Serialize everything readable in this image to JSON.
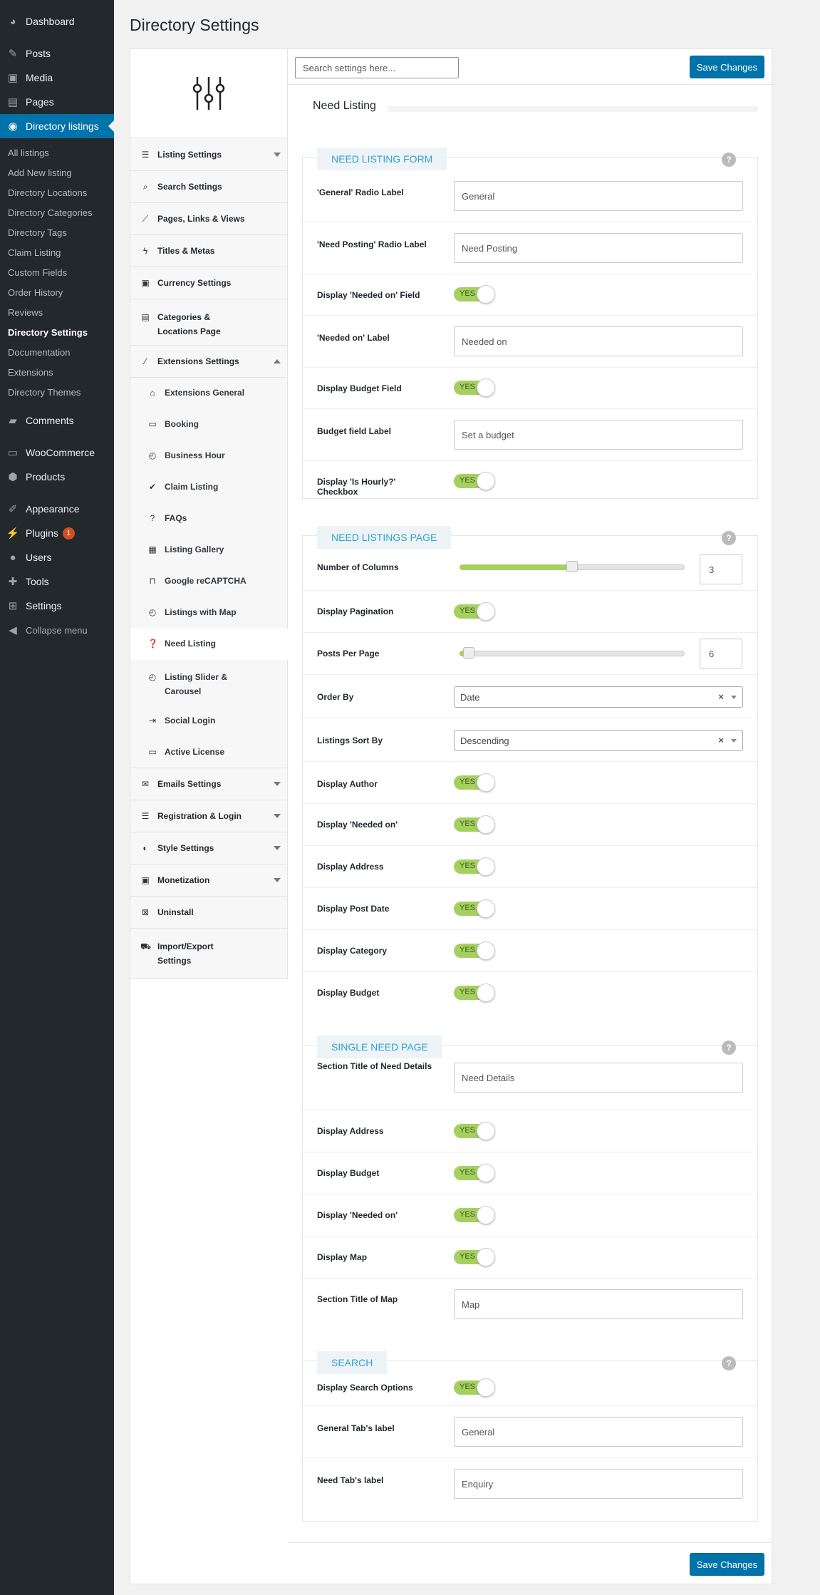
{
  "admin_menu": {
    "top_items": [
      {
        "label": "Dashboard",
        "icon": "dashboard-icon"
      },
      {
        "label": "Posts",
        "icon": "pin-icon"
      },
      {
        "label": "Media",
        "icon": "media-icon"
      },
      {
        "label": "Pages",
        "icon": "pages-icon"
      },
      {
        "label": "Directory listings",
        "icon": "directory-icon"
      }
    ],
    "sub_items": [
      "All listings",
      "Add New listing",
      "Directory Locations",
      "Directory Categories",
      "Directory Tags",
      "Claim Listing",
      "Custom Fields",
      "Order History",
      "Reviews",
      "Directory Settings",
      "Documentation",
      "Extensions",
      "Directory Themes"
    ],
    "bottom_items": [
      {
        "label": "Comments",
        "icon": "comments-icon"
      },
      {
        "label": "WooCommerce",
        "icon": "woocommerce-icon"
      },
      {
        "label": "Products",
        "icon": "products-icon"
      },
      {
        "label": "Appearance",
        "icon": "appearance-icon"
      },
      {
        "label": "Plugins",
        "icon": "plugins-icon",
        "badge": "1"
      },
      {
        "label": "Users",
        "icon": "users-icon"
      },
      {
        "label": "Tools",
        "icon": "tools-icon"
      },
      {
        "label": "Settings",
        "icon": "settings-icon"
      }
    ],
    "collapse_label": "Collapse menu"
  },
  "page_title": "Directory Settings",
  "search": {
    "placeholder": "Search settings here..."
  },
  "save_label": "Save Changes",
  "sidebar": {
    "items": [
      {
        "label": "Listing Settings",
        "icon": "list-icon"
      },
      {
        "label": "Search Settings",
        "icon": "search-icon"
      },
      {
        "label": "Pages, Links & Views",
        "icon": "chart-line-icon"
      },
      {
        "label": "Titles & Metas",
        "icon": "bolt-icon"
      },
      {
        "label": "Currency Settings",
        "icon": "money-icon"
      },
      {
        "label": "Categories & Locations Page",
        "icon": "categories-icon"
      },
      {
        "label": "Extensions Settings",
        "icon": "magic-wand-icon"
      },
      {
        "label": "Emails Settings",
        "icon": "envelope-icon"
      },
      {
        "label": "Registration & Login",
        "icon": "registration-icon"
      },
      {
        "label": "Style Settings",
        "icon": "adjust-icon"
      },
      {
        "label": "Monetization",
        "icon": "money-icon"
      },
      {
        "label": "Uninstall",
        "icon": "times-square-icon"
      },
      {
        "label": "Import/Export Settings",
        "icon": "truck-icon"
      }
    ],
    "extensions": [
      {
        "label": "Extensions General",
        "icon": "home-icon"
      },
      {
        "label": "Booking",
        "icon": "id-card-icon"
      },
      {
        "label": "Business Hour",
        "icon": "clock-icon"
      },
      {
        "label": "Claim Listing",
        "icon": "check-icon"
      },
      {
        "label": "FAQs",
        "icon": "question-icon"
      },
      {
        "label": "Listing Gallery",
        "icon": "grid-icon"
      },
      {
        "label": "Google reCAPTCHA",
        "icon": "unlock-icon"
      },
      {
        "label": "Listings with Map",
        "icon": "clock-icon"
      },
      {
        "label": "Need Listing",
        "icon": "question-circle-icon"
      },
      {
        "label": "Listing Slider & Carousel",
        "icon": "clock-icon"
      },
      {
        "label": "Social Login",
        "icon": "sign-in-icon"
      },
      {
        "label": "Active License",
        "icon": "id-card-icon"
      }
    ]
  },
  "section_title": "Need Listing",
  "help_glyph": "?",
  "groups": {
    "form": {
      "title": "NEED LISTING FORM",
      "rows": [
        {
          "label": "'General' Radio Label",
          "value": "General"
        },
        {
          "label": "'Need Posting' Radio Label",
          "value": "Need Posting"
        },
        {
          "label": "Display 'Needed on' Field",
          "value": "YES"
        },
        {
          "label": "'Needed on' Label",
          "value": "Needed on"
        },
        {
          "label": "Display Budget Field",
          "value": "YES"
        },
        {
          "label": "Budget field Label",
          "value": "Set a budget"
        },
        {
          "label": "Display 'Is Hourly?' Checkbox",
          "value": "YES"
        }
      ]
    },
    "page": {
      "title": "NEED LISTINGS PAGE",
      "rows": [
        {
          "label": "Number of Columns",
          "value": "3",
          "level": 0.5
        },
        {
          "label": "Display Pagination",
          "value": "YES"
        },
        {
          "label": "Posts Per Page",
          "value": "6",
          "level": 0.04
        },
        {
          "label": "Order By",
          "value": "Date"
        },
        {
          "label": "Listings Sort By",
          "value": "Descending"
        },
        {
          "label": "Display Author",
          "value": "YES"
        },
        {
          "label": "Display 'Needed on'",
          "value": "YES"
        },
        {
          "label": "Display Address",
          "value": "YES"
        },
        {
          "label": "Display Post Date",
          "value": "YES"
        },
        {
          "label": "Display Category",
          "value": "YES"
        },
        {
          "label": "Display Budget",
          "value": "YES"
        }
      ]
    },
    "single": {
      "title": "SINGLE NEED PAGE",
      "rows": [
        {
          "label": "Section Title of Need Details",
          "value": "Need Details"
        },
        {
          "label": "Display Address",
          "value": "YES"
        },
        {
          "label": "Display Budget",
          "value": "YES"
        },
        {
          "label": "Display 'Needed on'",
          "value": "YES"
        },
        {
          "label": "Display Map",
          "value": "YES"
        },
        {
          "label": "Section Title of Map",
          "value": "Map"
        }
      ]
    },
    "search": {
      "title": "SEARCH",
      "rows": [
        {
          "label": "Display Search Options",
          "value": "YES"
        },
        {
          "label": "General Tab's label",
          "value": "General"
        },
        {
          "label": "Need Tab's label",
          "value": "Enquiry"
        }
      ]
    }
  },
  "colors": {
    "accent": "#0073aa",
    "toggle_on": "#a5d05f",
    "group_title": "#2ea2cc"
  }
}
